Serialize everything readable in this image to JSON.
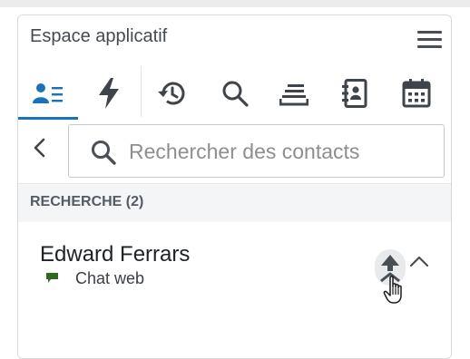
{
  "header": {
    "title": "Espace applicatif",
    "menu_icon": "hamburger-menu-icon"
  },
  "tabs": [
    {
      "name": "contacts",
      "icon": "contact-list-icon",
      "active": true
    },
    {
      "name": "actions",
      "icon": "lightning-icon",
      "active": false
    },
    {
      "name": "history",
      "icon": "history-icon",
      "active": false
    },
    {
      "name": "search",
      "icon": "search-icon",
      "active": false
    },
    {
      "name": "queue",
      "icon": "queue-tray-icon",
      "active": false
    },
    {
      "name": "directory",
      "icon": "address-book-icon",
      "active": false
    },
    {
      "name": "calendar",
      "icon": "calendar-icon",
      "active": false
    }
  ],
  "search": {
    "placeholder": "Rechercher des contacts",
    "value": ""
  },
  "results": {
    "heading": "RECHERCHE (2)",
    "items": [
      {
        "name": "Edward Ferrars",
        "channel": "Chat web",
        "channel_icon": "chat-bubble-icon"
      }
    ]
  },
  "colors": {
    "accent": "#1a73b8",
    "icon": "#3f444a",
    "chat_green": "#2e6b1f"
  }
}
